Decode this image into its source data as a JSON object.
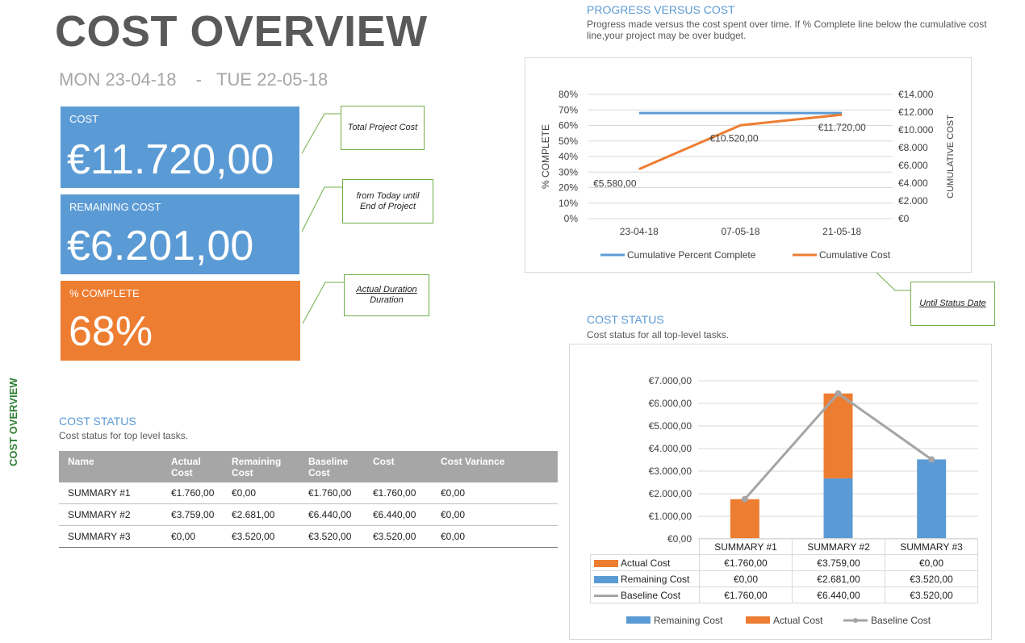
{
  "header": {
    "title": "COST OVERVIEW",
    "date_start": "MON 23-04-18",
    "date_sep": "-",
    "date_end": "TUE 22-05-18"
  },
  "side_label": "COST OVERVIEW",
  "tiles": {
    "cost": {
      "label": "COST",
      "value": "€11.720,00"
    },
    "remaining": {
      "label": "REMAINING COST",
      "value": "€6.201,00"
    },
    "complete": {
      "label": "% COMPLETE",
      "value": "68%"
    }
  },
  "callouts": {
    "total": "Total Project Cost",
    "remaining": "from Today until End of Project",
    "duration_line1": "Actual Duration",
    "duration_line2": "Duration",
    "status_date": "Until Status Date"
  },
  "progress": {
    "title": "PROGRESS VERSUS COST",
    "subtitle": "Progress made versus the cost spent over time. If % Complete line below the cumulative cost line,your project may be over budget."
  },
  "cost_status_table": {
    "title": "COST STATUS",
    "subtitle": "Cost status for top level tasks.",
    "headers": [
      "Name",
      "Actual Cost",
      "Remaining Cost",
      "Baseline Cost",
      "Cost",
      "Cost Variance"
    ],
    "rows": [
      [
        "SUMMARY #1",
        "€1.760,00",
        "€0,00",
        "€1.760,00",
        "€1.760,00",
        "€0,00"
      ],
      [
        "SUMMARY #2",
        "€3.759,00",
        "€2.681,00",
        "€6.440,00",
        "€6.440,00",
        "€0,00"
      ],
      [
        "SUMMARY #3",
        "€0,00",
        "€3.520,00",
        "€3.520,00",
        "€3.520,00",
        "€0,00"
      ]
    ]
  },
  "cost_status_chart": {
    "title": "COST STATUS",
    "subtitle": "Cost status for all top-level tasks."
  },
  "colors": {
    "blue": "#5b9bd5",
    "orange": "#ed7d31",
    "gray": "#a5a5a5",
    "green": "#70ad47"
  },
  "chart_data": [
    {
      "type": "line",
      "x": [
        "23-04-18",
        "07-05-18",
        "21-05-18"
      ],
      "y_left_ticks": [
        "80%",
        "70%",
        "60%",
        "50%",
        "40%",
        "30%",
        "20%",
        "10%",
        "0%"
      ],
      "y_right_ticks": [
        "€14.000",
        "€12.000",
        "€10.000",
        "€8.000",
        "€6.000",
        "€4.000",
        "€2.000",
        "€0"
      ],
      "ylabel_left": "% COMPLETE",
      "ylabel_right": "CUMULATIVE COST",
      "ylim_left": [
        0,
        80
      ],
      "ylim_right": [
        0,
        14000
      ],
      "series": [
        {
          "name": "Cumulative Percent Complete",
          "axis": "left",
          "values": [
            68,
            68,
            68
          ],
          "color": "#5b9bd5"
        },
        {
          "name": "Cumulative Cost",
          "axis": "right",
          "values": [
            5580,
            10520,
            11720
          ],
          "color": "#ed7d31",
          "labels": [
            "€5.580,00",
            "€10.520,00",
            "€11.720,00"
          ]
        }
      ],
      "legend": "bottom",
      "grid": true
    },
    {
      "type": "bar",
      "stacked": true,
      "categories": [
        "SUMMARY #1",
        "SUMMARY #2",
        "SUMMARY #3"
      ],
      "y_ticks": [
        "€7.000,00",
        "€6.000,00",
        "€5.000,00",
        "€4.000,00",
        "€3.000,00",
        "€2.000,00",
        "€1.000,00",
        "€0,00"
      ],
      "ylim": [
        0,
        7000
      ],
      "series": [
        {
          "name": "Actual Cost",
          "kind": "bar",
          "values": [
            1760,
            3759,
            0
          ],
          "color": "#ed7d31",
          "labels": [
            "€1.760,00",
            "€3.759,00",
            "€0,00"
          ]
        },
        {
          "name": "Remaining Cost",
          "kind": "bar",
          "values": [
            0,
            2681,
            3520
          ],
          "color": "#5b9bd5",
          "labels": [
            "€0,00",
            "€2.681,00",
            "€3.520,00"
          ]
        },
        {
          "name": "Baseline Cost",
          "kind": "line",
          "values": [
            1760,
            6440,
            3520
          ],
          "color": "#a5a5a5",
          "labels": [
            "€1.760,00",
            "€6.440,00",
            "€3.520,00"
          ]
        }
      ],
      "legend_order": [
        "Remaining Cost",
        "Actual Cost",
        "Baseline Cost"
      ],
      "legend": "bottom",
      "grid": true,
      "data_table": true
    }
  ]
}
